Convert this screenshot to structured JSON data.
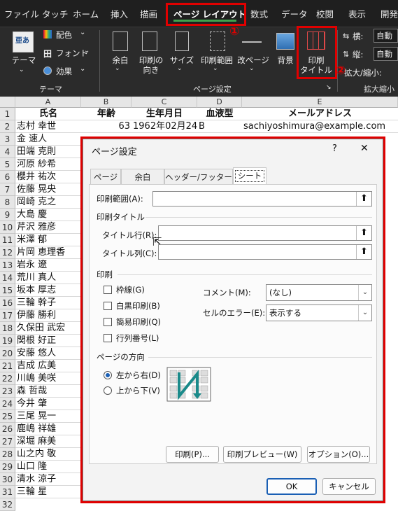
{
  "ribbon": {
    "tabs": [
      "ファイル",
      "タッチ",
      "ホーム",
      "挿入",
      "描画",
      "ページ レイアウト",
      "数式",
      "データ",
      "校閲",
      "表示",
      "開発"
    ],
    "active_tab": "ページ レイアウト",
    "theme_group": {
      "theme_label": "テーマ",
      "colors": "配色",
      "fonts": "フォント",
      "effects": "効果",
      "group_label": "テーマ"
    },
    "page_setup_group": {
      "margins": "余白",
      "orientation_1": "印刷の",
      "orientation_2": "向き",
      "size": "サイズ",
      "print_area": "印刷範囲",
      "breaks": "改ページ",
      "background": "背景",
      "print_titles_1": "印刷",
      "print_titles_2": "タイトル",
      "group_label": "ページ設定"
    },
    "scale_group": {
      "width_label": "横:",
      "height_label": "縦:",
      "width_value": "自動",
      "height_value": "自動",
      "scale_label": "拡大/縮小:",
      "group_label": "拡大縮小"
    },
    "markers": {
      "one": "①",
      "two": "②"
    }
  },
  "sheet": {
    "columns": [
      "A",
      "B",
      "C",
      "D",
      "E"
    ],
    "header_row": {
      "name": "氏名",
      "age": "年齢",
      "birth": "生年月日",
      "blood": "血液型",
      "email": "メールアドレス"
    },
    "row2": {
      "name": "志村 幸世",
      "age": "63",
      "birth": "1962年02月24日",
      "blood": "B",
      "email": "sachiyoshimura@example.com"
    },
    "names": [
      "金 速人",
      "田端 克則",
      "河原 紗希",
      "櫻井 祐次",
      "佐藤 晃央",
      "岡崎 克之",
      "大島 慶",
      "芹沢 雅彦",
      "米澤 郁",
      "片岡 恵理香",
      "岩永 遼",
      "荒川 真人",
      "坂本 厚志",
      "三輪 幹子",
      "伊藤 勝利",
      "久保田 武宏",
      "関根 好正",
      "安藤 悠人",
      "吉成 広美",
      "川嶋 美咲",
      "森 哲哉",
      "今井 肇",
      "三尾 晃一",
      "鹿嶋 祥雄",
      "深堀 麻美",
      "山之内 敬",
      "山口 隆",
      "清水 涼子",
      "三輪 星"
    ],
    "row_numbers": [
      "1",
      "2",
      "3",
      "4",
      "5",
      "6",
      "7",
      "8",
      "9",
      "10",
      "11",
      "12",
      "13",
      "14",
      "15",
      "16",
      "17",
      "18",
      "19",
      "20",
      "21",
      "22",
      "23",
      "24",
      "25",
      "26",
      "27",
      "28",
      "29",
      "30",
      "31",
      "32"
    ]
  },
  "dialog": {
    "title": "ページ設定",
    "help": "?",
    "close": "✕",
    "tabs": [
      "ページ",
      "余白",
      "ヘッダー/フッター",
      "シート"
    ],
    "print_area_label": "印刷範囲(A):",
    "print_titles_section": "印刷タイトル",
    "title_rows_label": "タイトル行(R):",
    "title_cols_label": "タイトル列(C):",
    "print_section": "印刷",
    "gridlines": "枠線(G)",
    "black_white": "白黒印刷(B)",
    "draft": "簡易印刷(Q)",
    "row_col_headings": "行列番号(L)",
    "comments_label": "コメント(M):",
    "comments_value": "(なし)",
    "errors_label": "セルのエラー(E):",
    "errors_value": "表示する",
    "page_order_section": "ページの方向",
    "down_then_over": "左から右(D)",
    "over_then_down": "上から下(V)",
    "print_btn": "印刷(P)...",
    "preview_btn": "印刷プレビュー(W)",
    "options_btn": "オプション(O)...",
    "ok_btn": "OK",
    "cancel_btn": "キャンセル"
  }
}
